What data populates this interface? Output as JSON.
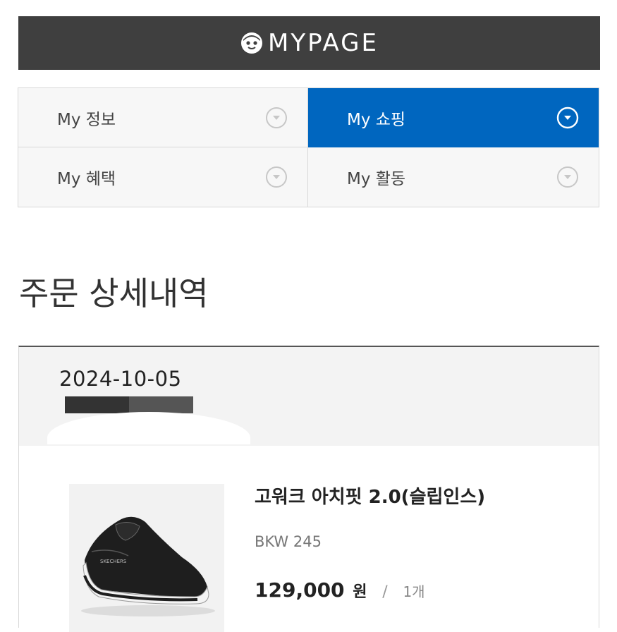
{
  "header": {
    "title": "MYPAGE",
    "logo_icon": "smiley-face-icon",
    "background": "#3f3f3f"
  },
  "menu": {
    "accent_color": "#0066bf",
    "items": [
      {
        "label": "My 정보",
        "icon": "chevron-down-circle-icon",
        "active": false
      },
      {
        "label": "My 쇼핑",
        "icon": "chevron-down-circle-icon",
        "active": true
      },
      {
        "label": "My 혜택",
        "icon": "chevron-down-circle-icon",
        "active": false
      },
      {
        "label": "My 활동",
        "icon": "chevron-down-circle-icon",
        "active": false
      }
    ]
  },
  "page": {
    "title": "주문 상세내역"
  },
  "order": {
    "date": "2024-10-05",
    "product": {
      "name": "고워크 아치핏 2.0(슬립인스)",
      "option": "BKW 245",
      "price": "129,000",
      "currency": "원",
      "separator": "/",
      "quantity": "1개",
      "image": "black-slip-on-sneaker-image"
    }
  }
}
